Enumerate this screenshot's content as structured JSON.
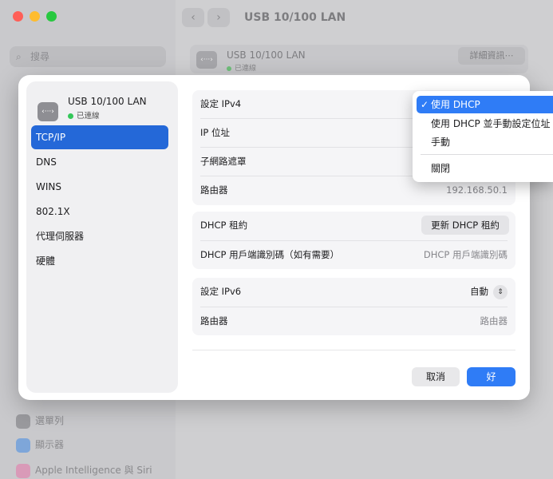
{
  "background": {
    "title": "USB 10/100 LAN",
    "search_placeholder": "搜尋",
    "card": {
      "title": "USB 10/100 LAN",
      "status": "已連線",
      "details_button": "詳細資訊⋯"
    },
    "sidebar_items": [
      "選單列",
      "顯示器",
      "Apple Intelligence 與 Siri"
    ]
  },
  "dialog": {
    "header": {
      "title": "USB 10/100 LAN",
      "status": "已連線"
    },
    "nav": [
      "TCP/IP",
      "DNS",
      "WINS",
      "802.1X",
      "代理伺服器",
      "硬體"
    ],
    "selected_nav": "TCP/IP",
    "ipv4": {
      "configure_label": "設定 IPv4",
      "ip_label": "IP 位址",
      "subnet_label": "子網路遮罩",
      "router_label": "路由器",
      "router_value": "192.168.50.1"
    },
    "dhcp": {
      "lease_label": "DHCP 租約",
      "renew_button": "更新 DHCP 租約",
      "client_id_label": "DHCP 用戶端識別碼（如有需要）",
      "client_id_placeholder": "DHCP 用戶端識別碼"
    },
    "ipv6": {
      "configure_label": "設定 IPv6",
      "configure_value": "自動",
      "router_label": "路由器",
      "router_placeholder": "路由器"
    },
    "buttons": {
      "cancel": "取消",
      "ok": "好"
    }
  },
  "ipv4_menu": {
    "options": [
      "使用 DHCP",
      "使用 DHCP 並手動設定位址",
      "手動",
      "關閉"
    ],
    "selected": "使用 DHCP",
    "check": "✓"
  },
  "colors": {
    "accent": "#2f7cf6",
    "selected_nav": "#2468d8",
    "status_green": "#34c759"
  }
}
